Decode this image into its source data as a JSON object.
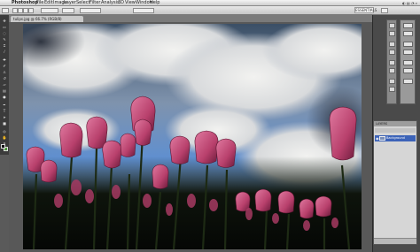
{
  "menubar": {
    "app_name": "Photoshop",
    "items": [
      "File",
      "Edit",
      "Image",
      "Layer",
      "Select",
      "Filter",
      "Analysis",
      "3D",
      "View",
      "Window",
      "Help"
    ]
  },
  "options": {
    "workspace": "ESSENTIALS"
  },
  "document": {
    "tab_label": "tulips.jpg @ 66.7% (RGB/8)"
  },
  "layers_panel": {
    "title": "LAYERS",
    "layer_name": "Background"
  },
  "colors": {
    "foreground": "#111111",
    "background": "#4c9a3a",
    "selected_layer": "#3c63b8"
  }
}
